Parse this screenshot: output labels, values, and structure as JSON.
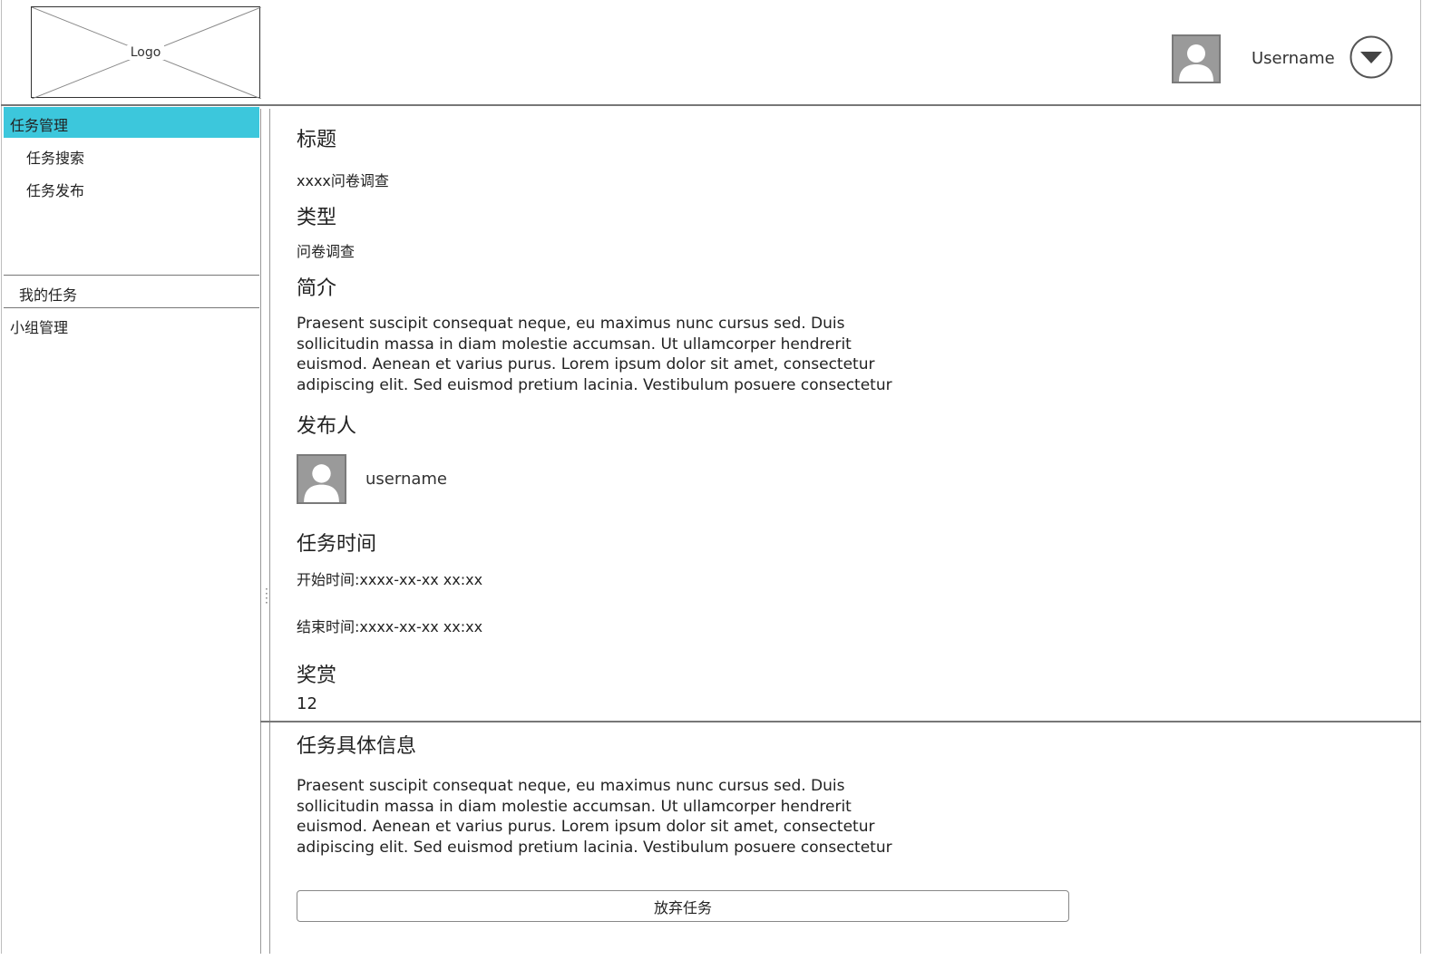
{
  "header": {
    "logo_text": "Logo",
    "username": "Username"
  },
  "sidebar": {
    "items": [
      {
        "label": "任务管理",
        "active": true
      },
      {
        "label": "任务搜索"
      },
      {
        "label": "任务发布"
      },
      {
        "label": "我的任务"
      },
      {
        "label": "小组管理"
      }
    ]
  },
  "task": {
    "title_heading": "标题",
    "title_value": "xxxx问卷调查",
    "type_heading": "类型",
    "type_value": "问卷调查",
    "intro_heading": "简介",
    "intro_text": "Praesent suscipit consequat neque, eu maximus nunc cursus sed. Duis sollicitudin massa in diam molestie accumsan. Ut ullamcorper hendrerit euismod. Aenean et varius purus. Lorem ipsum dolor sit amet, consectetur adipiscing elit. Sed euismod pretium lacinia. Vestibulum posuere consectetur",
    "publisher_heading": "发布人",
    "publisher_name": "username",
    "time_heading": "任务时间",
    "start_time": "开始时间:xxxx-xx-xx xx:xx",
    "end_time": "结束时间:xxxx-xx-xx xx:xx",
    "reward_heading": "奖赏",
    "reward_value": "12",
    "detail_heading": "任务具体信息",
    "detail_text": "Praesent suscipit consequat neque, eu maximus nunc cursus sed. Duis sollicitudin massa in diam molestie accumsan. Ut ullamcorper hendrerit euismod. Aenean et varius purus. Lorem ipsum dolor sit amet, consectetur adipiscing elit. Sed euismod pretium lacinia. Vestibulum posuere consectetur",
    "abandon_button": "放弃任务"
  },
  "colors": {
    "active_nav": "#3cc7dc",
    "avatar_bg": "#9a9a9a"
  },
  "icons": {
    "avatar": "user-avatar-icon",
    "dropdown": "chevron-down-icon",
    "splitter": "splitter-handle-icon"
  }
}
